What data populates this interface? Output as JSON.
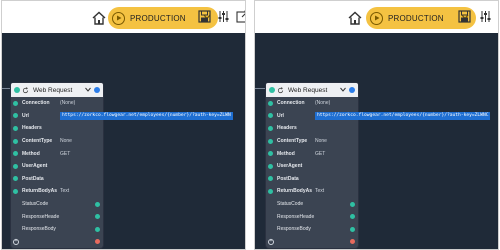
{
  "toolbar": {
    "environment_label": "PRODUCTION"
  },
  "node": {
    "title": "Web Request",
    "properties": [
      {
        "name": "Connection",
        "value": "(None)",
        "bold": true,
        "input": true,
        "output": false
      },
      {
        "name": "Url",
        "value": "https://zorkco.flowgear.net/employees/{number}/?auth-key=ZLWN",
        "bold": true,
        "input": true,
        "output": false,
        "highlight": true
      },
      {
        "name": "Headers",
        "value": "",
        "bold": true,
        "input": true,
        "output": false
      },
      {
        "name": "ContentType",
        "value": "None",
        "bold": true,
        "input": true,
        "output": false
      },
      {
        "name": "Method",
        "value": "GET",
        "bold": true,
        "input": true,
        "output": false
      },
      {
        "name": "UserAgent",
        "value": "",
        "bold": true,
        "input": true,
        "output": false
      },
      {
        "name": "PostData",
        "value": "",
        "bold": true,
        "input": true,
        "output": false
      },
      {
        "name": "ReturnBodyAs",
        "value": "Text",
        "bold": true,
        "input": true,
        "output": false
      },
      {
        "name": "StatusCode",
        "value": "",
        "bold": false,
        "input": false,
        "output": true
      },
      {
        "name": "ResponseHeade",
        "value": "",
        "bold": false,
        "input": false,
        "output": true
      },
      {
        "name": "ResponseBody",
        "value": "",
        "bold": false,
        "input": false,
        "output": true
      }
    ],
    "add_symbol": "+"
  },
  "node_right": {
    "url_value": "https://zorkco.flowgear.net/employees/{number}/?auth-key=ZLWNC"
  },
  "colors": {
    "canvas": "#1f2a38",
    "node_body": "#3b4452",
    "accent_yellow": "#f4c242",
    "connector_green": "#2fc0a3",
    "connector_red": "#e86a5d",
    "highlight_blue": "#1f6fd2"
  },
  "icons": [
    "home-icon",
    "play-icon",
    "chevron-down-icon",
    "save-icon",
    "sliders-icon",
    "external-link-icon",
    "refresh-icon",
    "add-icon"
  ]
}
